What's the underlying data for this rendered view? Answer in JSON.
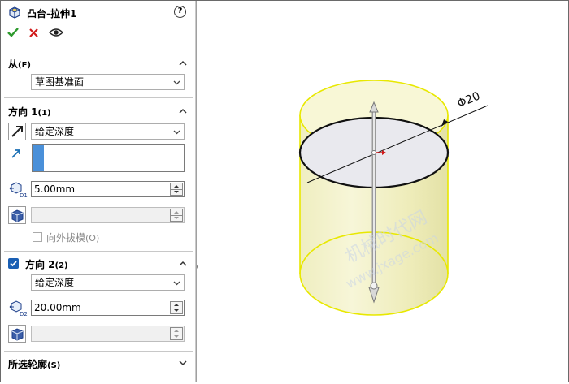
{
  "panel": {
    "title": "凸台-拉伸1",
    "help_label": "?",
    "from": {
      "heading": "从",
      "heading_key": "(F)",
      "value": "草图基准面"
    },
    "direction1": {
      "heading": "方向 1",
      "heading_key": "(1)",
      "end_condition": "给定深度",
      "depth": "5.00mm",
      "depth_icon_label": "D1",
      "draft_label": "向外拔模",
      "draft_key": "(O)"
    },
    "direction2": {
      "heading": "方向 2",
      "heading_key": "(2)",
      "end_condition": "给定深度",
      "depth": "20.00mm",
      "depth_icon_label": "D2"
    },
    "selected_contours": {
      "heading": "所选轮廓",
      "heading_key": "(S)"
    }
  },
  "viewport": {
    "diameter_label": "Φ20",
    "watermark_line1": "机械时代网",
    "watermark_line2": "www.jxage.com"
  },
  "colors": {
    "cylinder_fill": "#f3f1c4",
    "cylinder_edge": "#e8e800",
    "accent_blue": "#4a90d9",
    "ok_green": "#2d9a2d",
    "cancel_red": "#d11a1a"
  }
}
